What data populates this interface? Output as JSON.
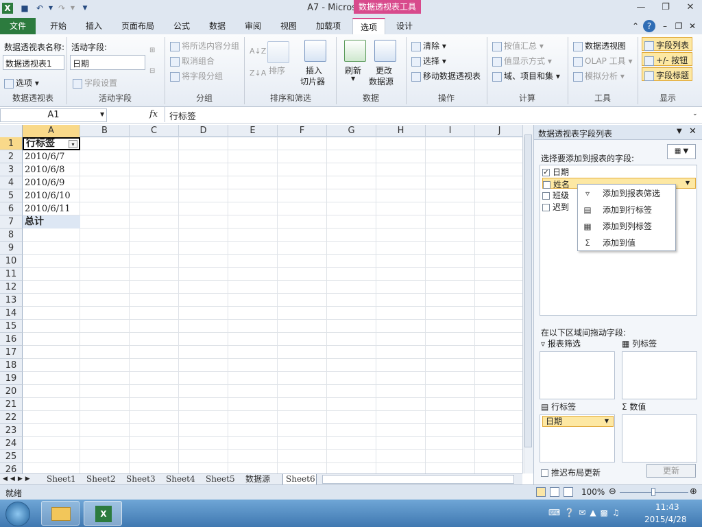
{
  "window": {
    "title": "A7  -  Microsoft Excel",
    "contextual_tab_title": "数据透视表工具"
  },
  "tabs": [
    "文件",
    "开始",
    "插入",
    "页面布局",
    "公式",
    "数据",
    "审阅",
    "视图",
    "加载项",
    "选项",
    "设计"
  ],
  "ribbon": {
    "pivot": {
      "name_label": "数据透视表名称:",
      "name_value": "数据透视表1",
      "options": "选项",
      "group": "数据透视表"
    },
    "active_field": {
      "label": "活动字段:",
      "value": "日期",
      "settings": "字段设置",
      "group": "活动字段"
    },
    "group_grp": {
      "group_selection": "将所选内容分组",
      "ungroup": "取消组合",
      "group_field": "将字段分组",
      "group": "分组"
    },
    "sort": {
      "sort": "排序",
      "insert_slicer_1": "插入",
      "insert_slicer_2": "切片器",
      "group": "排序和筛选"
    },
    "data": {
      "refresh": "刷新",
      "change_source_1": "更改",
      "change_source_2": "数据源",
      "group": "数据"
    },
    "actions": {
      "clear": "清除",
      "select": "选择",
      "move": "移动数据透视表",
      "group": "操作"
    },
    "calc": {
      "summarize": "按值汇总",
      "show_values": "值显示方式",
      "fields_items": "域、项目和集",
      "group": "计算"
    },
    "tools": {
      "pivot_chart": "数据透视图",
      "olap": "OLAP 工具",
      "whatif": "模拟分析",
      "group": "工具"
    },
    "show": {
      "field_list": "字段列表",
      "buttons": "+/- 按钮",
      "headers": "字段标题",
      "group": "显示"
    }
  },
  "formula_bar": {
    "name_box": "A1",
    "fx": "fx",
    "content": "行标签"
  },
  "columns": [
    "A",
    "B",
    "C",
    "D",
    "E",
    "F",
    "G",
    "H",
    "I",
    "J"
  ],
  "rows": [
    "1",
    "2",
    "3",
    "4",
    "5",
    "6",
    "7",
    "8",
    "9",
    "10",
    "11",
    "12",
    "13",
    "14",
    "15",
    "16",
    "17",
    "18",
    "19",
    "20",
    "21",
    "22",
    "23",
    "24",
    "25",
    "26"
  ],
  "cells": {
    "A1": "行标签",
    "A2": "2010/6/7",
    "A3": "2010/6/8",
    "A4": "2010/6/9",
    "A5": "2010/6/10",
    "A6": "2010/6/11",
    "A7": "总计"
  },
  "sheet_tabs": [
    "Sheet1",
    "Sheet2",
    "Sheet3",
    "Sheet4",
    "Sheet5",
    "数据源",
    "Sheet6"
  ],
  "status": {
    "ready": "就绪",
    "zoom": "100%"
  },
  "pane": {
    "title": "数据透视表字段列表",
    "choose_label": "选择要添加到报表的字段:",
    "fields": [
      {
        "name": "日期",
        "checked": true
      },
      {
        "name": "姓名",
        "checked": false
      },
      {
        "name": "班级",
        "checked": false
      },
      {
        "name": "迟到",
        "checked": false
      }
    ],
    "drag_label": "在以下区域间拖动字段:",
    "area_filter": "报表筛选",
    "area_columns": "列标签",
    "area_rows": "行标签",
    "area_values": "数值",
    "row_field": "日期",
    "defer_label": "推迟布局更新",
    "update_button": "更新"
  },
  "context_menu": [
    "添加到报表筛选",
    "添加到行标签",
    "添加到列标签",
    "添加到值"
  ],
  "taskbar": {
    "time": "11:43",
    "date": "2015/4/28"
  },
  "colors": {
    "file_tab": "#2c7b3e",
    "contextual": "#d84a8c",
    "highlight": "#fde8a3"
  }
}
